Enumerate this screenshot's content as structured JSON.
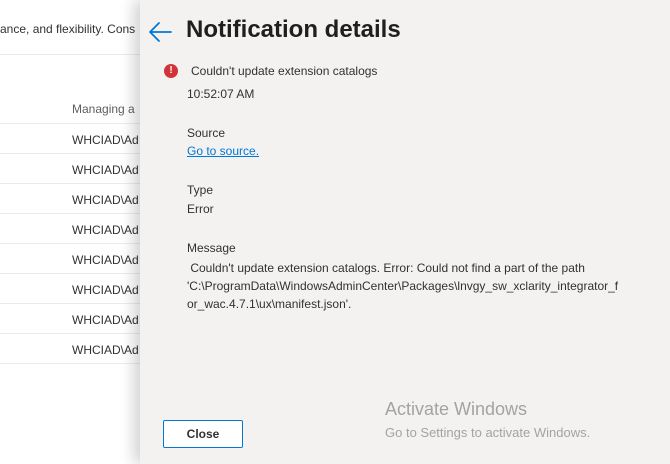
{
  "background": {
    "banner_text": "ance, and flexibility. Cons",
    "column_header": "Managing a",
    "rows": [
      "WHCIAD\\Ad",
      "WHCIAD\\Ad",
      "WHCIAD\\Ad",
      "WHCIAD\\Ad",
      "WHCIAD\\Ad",
      "WHCIAD\\Ad",
      "WHCIAD\\Ad",
      "WHCIAD\\Ad"
    ]
  },
  "panel": {
    "back_icon": "back-arrow-icon",
    "title": "Notification details",
    "notification": {
      "status_icon": "error-icon",
      "status_color": "#d13438",
      "title": "Couldn't update extension catalogs",
      "time": "10:52:07 AM"
    },
    "source": {
      "label": "Source",
      "link": "Go to source."
    },
    "type": {
      "label": "Type",
      "value": "Error"
    },
    "message": {
      "label": "Message",
      "lines": [
        " Couldn't update extension catalogs. Error: Could not find a part of the path",
        "'C:\\ProgramData\\WindowsAdminCenter\\Packages\\lnvgy_sw_xclarity_integrator_f",
        "or_wac.4.7.1\\ux\\manifest.json'."
      ]
    },
    "close_button": "Close"
  },
  "watermark": {
    "title": "Activate Windows",
    "subtitle": "Go to Settings to activate Windows."
  },
  "colors": {
    "accent": "#0078d4",
    "panel_bg": "#f3f2f1",
    "error": "#d13438"
  }
}
